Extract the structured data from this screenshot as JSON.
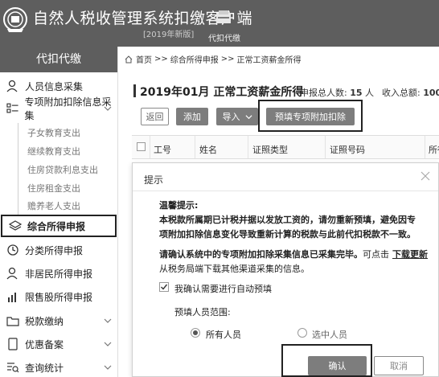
{
  "app": {
    "title": "自然人税收管理系统扣缴客户端",
    "subtitle": "[2019年新版]",
    "top_icon_label": "代扣代缴"
  },
  "sidebar": {
    "header": "代扣代缴",
    "items": [
      {
        "label": "人员信息采集",
        "icon": "person-icon"
      },
      {
        "label": "专项附加扣除信息采集",
        "icon": "list-icon"
      },
      {
        "label": "综合所得申报",
        "icon": "layers-icon"
      },
      {
        "label": "分类所得申报",
        "icon": "clock-icon"
      },
      {
        "label": "非居民所得申报",
        "icon": "person-icon"
      },
      {
        "label": "限售股所得申报",
        "icon": "bars-icon"
      },
      {
        "label": "税款缴纳",
        "icon": "folder-icon"
      },
      {
        "label": "优惠备案",
        "icon": "doc-icon"
      },
      {
        "label": "查询统计",
        "icon": "search-list-icon"
      }
    ],
    "subitems": [
      "子女教育支出",
      "继续教育支出",
      "住房贷款利息支出",
      "住房租金支出",
      "赡养老人支出"
    ]
  },
  "breadcrumb": {
    "home": "首页",
    "sep": ">>",
    "level2": "综合所得申报",
    "level3": "正常工资薪金所得"
  },
  "page": {
    "title": "2019年01月 正常工资薪金所得",
    "total_persons_label": "申报总人数:",
    "total_persons_value": "15",
    "total_persons_unit": "人",
    "income_label": "收入总额:",
    "income_value": "100"
  },
  "toolbar": {
    "back": "返回",
    "add": "添加",
    "import": "导入",
    "prefill": "预填专项附加扣除"
  },
  "table": {
    "columns": [
      "工号",
      "姓名",
      "证照类型",
      "证照号码",
      "所得"
    ]
  },
  "dialog": {
    "title": "提示",
    "notice_title": "温馨提示:",
    "notice_line1": "本税款所属期已计税并据以发放工资的，请勿重新预填，避免因专",
    "notice_line2": "项附加扣除信息变化导致重新计算的税款与此前代扣税款不一致。",
    "confirm_line_bold": "请确认系统中的专项附加扣除采集信息已采集完毕。",
    "confirm_line_tail": "可点击",
    "download_link": "下载更新",
    "confirm_line2": "从税务局端下载其他渠道采集的信息。",
    "auto_prefill_label": "我确认需要进行自动预填",
    "auto_prefill_checked": true,
    "range_label": "预填人员范围:",
    "range_options": [
      {
        "label": "所有人员",
        "selected": true
      },
      {
        "label": "选中人员",
        "selected": false
      }
    ],
    "ok": "确认",
    "cancel": "取消"
  }
}
